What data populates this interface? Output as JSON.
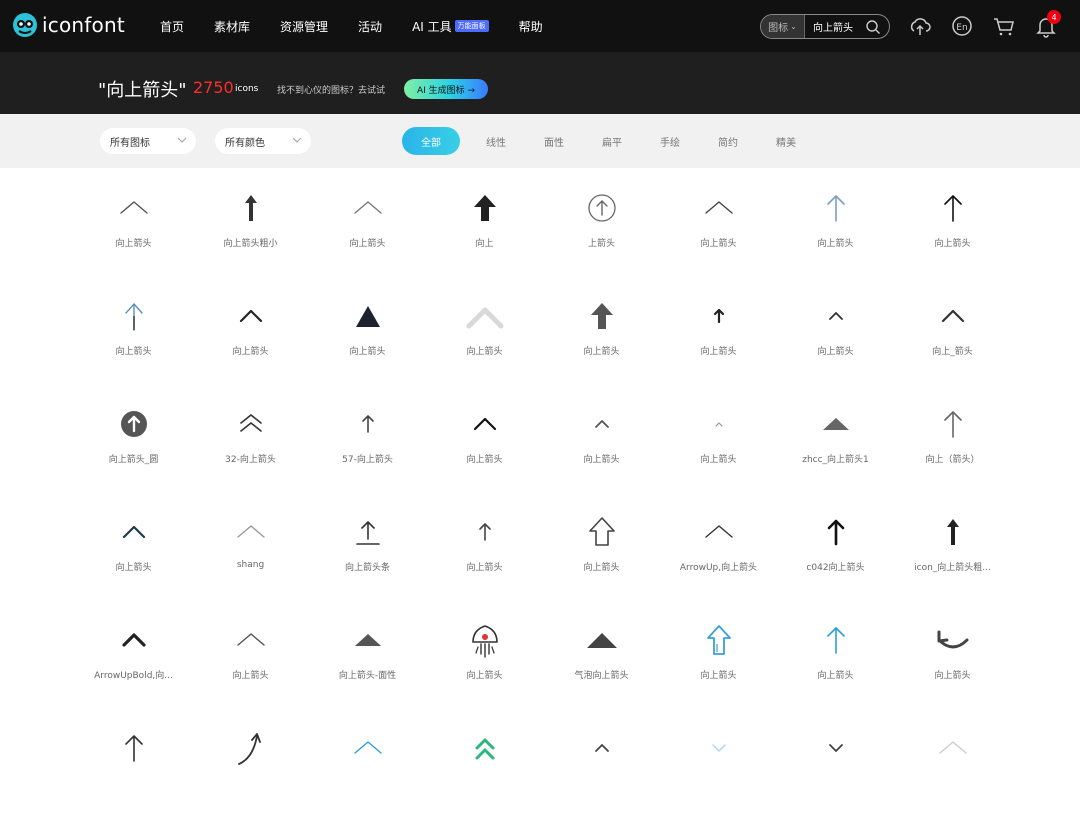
{
  "brand": {
    "name": "iconfont"
  },
  "nav": {
    "items": [
      {
        "label": "首页"
      },
      {
        "label": "素材库"
      },
      {
        "label": "资源管理"
      },
      {
        "label": "活动"
      },
      {
        "label": "AI 工具",
        "badge": "万能面板"
      },
      {
        "label": "帮助"
      }
    ]
  },
  "search": {
    "type": "图标",
    "value": "向上箭头"
  },
  "notifications": {
    "count": "4"
  },
  "hero": {
    "query_title": "\"向上箭头\"",
    "count": "2750",
    "unit": "icons",
    "tip": "找不到心仪的图标？去试试",
    "ai_button": "AI 生成图标 →"
  },
  "filters": {
    "icon_select": "所有图标",
    "color_select": "所有颜色",
    "tabs": [
      "全部",
      "线性",
      "面性",
      "扁平",
      "手绘",
      "简约",
      "精美"
    ],
    "active_tab": "全部"
  },
  "icons": [
    {
      "label": "向上箭头",
      "glyph": "chevron-thin",
      "color": "#555555"
    },
    {
      "label": "向上箭头粗小",
      "glyph": "arrow-bold-narrow",
      "color": "#333333"
    },
    {
      "label": "向上箭头",
      "glyph": "chevron-thin",
      "color": "#777777"
    },
    {
      "label": "向上",
      "glyph": "arrow-bold-head",
      "color": "#222222"
    },
    {
      "label": "上箭头",
      "glyph": "circle-arrow",
      "color": "#666666"
    },
    {
      "label": "向上箭头",
      "glyph": "chevron-thin",
      "color": "#444444"
    },
    {
      "label": "向上箭头",
      "glyph": "arrow-thin",
      "color": "#7a9fc4"
    },
    {
      "label": "向上箭头",
      "glyph": "arrow-thin",
      "color": "#111111"
    },
    {
      "label": "向上箭头",
      "glyph": "arrow-thin-blue",
      "color": "#5a8fc0"
    },
    {
      "label": "向上箭头",
      "glyph": "chevron-medium",
      "color": "#222222"
    },
    {
      "label": "向上箭头",
      "glyph": "triangle-solid",
      "color": "#1e2230"
    },
    {
      "label": "向上箭头",
      "glyph": "chevron-wide",
      "color": "#d9d9d9"
    },
    {
      "label": "向上箭头",
      "glyph": "arrow-bold-head",
      "color": "#555555"
    },
    {
      "label": "向上箭头",
      "glyph": "arrow-small-bold",
      "color": "#222222"
    },
    {
      "label": "向上箭头",
      "glyph": "chevron-small",
      "color": "#333333"
    },
    {
      "label": "向上_箭头",
      "glyph": "chevron-medium",
      "color": "#333333"
    },
    {
      "label": "向上箭头_圆",
      "glyph": "circle-solid-arrow",
      "color": "#555555"
    },
    {
      "label": "32-向上箭头",
      "glyph": "chevron-double",
      "color": "#333333"
    },
    {
      "label": "57-向上箭头",
      "glyph": "arrow-small-thin",
      "color": "#444444"
    },
    {
      "label": "向上箭头",
      "glyph": "chevron-medium",
      "color": "#111111"
    },
    {
      "label": "向上箭头",
      "glyph": "chevron-small",
      "color": "#555555"
    },
    {
      "label": "向上箭头",
      "glyph": "chevron-tiny",
      "color": "#999999"
    },
    {
      "label": "zhcc_向上箭头1",
      "glyph": "triangle-flat",
      "color": "#666666"
    },
    {
      "label": "向上（箭头）",
      "glyph": "arrow-thin",
      "color": "#666666"
    },
    {
      "label": "向上箭头",
      "glyph": "chevron-medium",
      "color": "#1c3a4a"
    },
    {
      "label": "shang",
      "glyph": "chevron-thin",
      "color": "#999999"
    },
    {
      "label": "向上箭头条",
      "glyph": "upload-bar",
      "color": "#333333"
    },
    {
      "label": "向上箭头",
      "glyph": "arrow-small-thin",
      "color": "#444444"
    },
    {
      "label": "向上箭头",
      "glyph": "arrow-outline",
      "color": "#444444"
    },
    {
      "label": "ArrowUp,向上箭头",
      "glyph": "chevron-thin",
      "color": "#333333"
    },
    {
      "label": "c042向上箭头",
      "glyph": "arrow-thin-bold",
      "color": "#111111"
    },
    {
      "label": "icon_向上箭头粗...",
      "glyph": "arrow-bold-narrow",
      "color": "#222222"
    },
    {
      "label": "ArrowUpBold,向...",
      "glyph": "chevron-bold",
      "color": "#222222"
    },
    {
      "label": "向上箭头",
      "glyph": "chevron-thin",
      "color": "#555555"
    },
    {
      "label": "向上箭头-面性",
      "glyph": "triangle-flat",
      "color": "#555555"
    },
    {
      "label": "向上箭头",
      "glyph": "rocket",
      "color": "#333333"
    },
    {
      "label": "气泡向上箭头",
      "glyph": "triangle-flat-large",
      "color": "#444444"
    },
    {
      "label": "向上箭头",
      "glyph": "arrow-outline-blue",
      "color": "#3aa0d8"
    },
    {
      "label": "向上箭头",
      "glyph": "arrow-thin",
      "color": "#2aa0d8"
    },
    {
      "label": "向上箭头",
      "glyph": "curve-arrow",
      "color": "#444444"
    },
    {
      "label": "",
      "glyph": "arrow-thin",
      "color": "#333333"
    },
    {
      "label": "",
      "glyph": "curve-up",
      "color": "#333333"
    },
    {
      "label": "",
      "glyph": "chevron-thin",
      "color": "#2aa0d8"
    },
    {
      "label": "",
      "glyph": "chevron-double-green",
      "color": "#2ab87a"
    },
    {
      "label": "",
      "glyph": "chevron-small",
      "color": "#444444"
    },
    {
      "label": "",
      "glyph": "chevron-down-light",
      "color": "#a8d8e8"
    },
    {
      "label": "",
      "glyph": "chevron-down-small",
      "color": "#444444"
    },
    {
      "label": "",
      "glyph": "chevron-thin",
      "color": "#cccccc"
    }
  ]
}
